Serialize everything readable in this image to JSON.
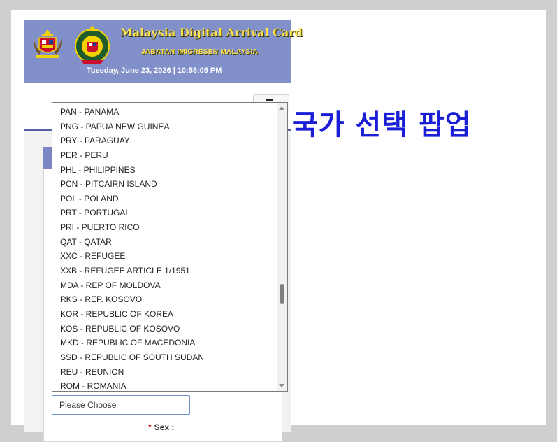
{
  "header": {
    "title": "Malaysia Digital Arrival Card",
    "subtitle": "JABATAN IMIGRESEN MALAYSIA",
    "datetime": "Tuesday, June 23, 2026 | 10:58:05 PM"
  },
  "dropdown": {
    "options": [
      "PAN - PANAMA",
      "PNG - PAPUA NEW GUINEA",
      "PRY - PARAGUAY",
      "PER - PERU",
      "PHL - PHILIPPINES",
      "PCN - PITCAIRN ISLAND",
      "POL - POLAND",
      "PRT - PORTUGAL",
      "PRI - PUERTO RICO",
      "QAT - QATAR",
      "XXC - REFUGEE",
      "XXB - REFUGEE ARTICLE 1/1951",
      "MDA - REP OF MOLDOVA",
      "RKS - REP. KOSOVO",
      "KOR - REPUBLIC OF KOREA",
      "KOS - REPUBLIC OF KOSOVO",
      "MKD - REPUBLIC OF MACEDONIA",
      "SSD - REPUBLIC OF SOUTH SUDAN",
      "REU - REUNION",
      "ROM - ROMANIA"
    ]
  },
  "select": {
    "value": "Please Choose"
  },
  "form": {
    "sex_required": "*",
    "sex_label": "Sex :"
  },
  "annotation": {
    "text": "국가 선택 팝업",
    "color": "#1a1fd6"
  },
  "colors": {
    "banner_bg": "#8190c8",
    "banner_title": "#ffe14a"
  }
}
